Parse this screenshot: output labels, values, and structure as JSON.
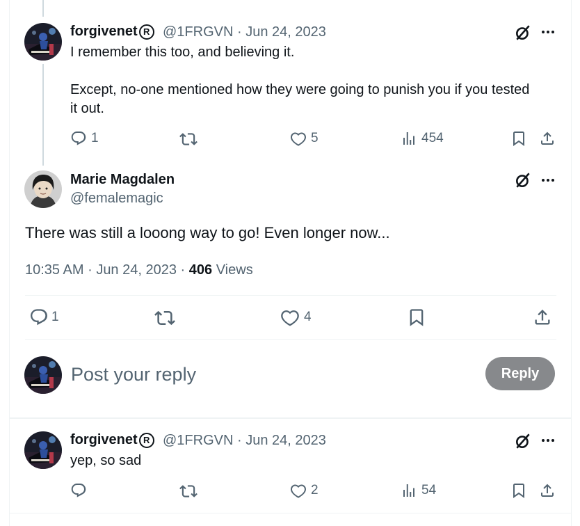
{
  "reply1": {
    "display_name": "forgivenet",
    "reg_mark": "R",
    "handle": "@1FRGVN",
    "separator": "·",
    "date": "Jun 24, 2023",
    "text_line1": "I remember this too, and believing it.",
    "text_line2": "Except, no-one mentioned how they were going to punish you if you tested",
    "text_line3": "it out.",
    "replies": "1",
    "likes": "5",
    "views": "454"
  },
  "main_post": {
    "display_name": "Marie Magdalen",
    "handle": "@femalemagic",
    "text": "There was still a looong way to go! Even longer now...",
    "time": "10:35 AM",
    "date": "Jun 24, 2023",
    "separator": "·",
    "views_count": "406",
    "views_label": "Views",
    "replies": "1",
    "likes": "4"
  },
  "composer": {
    "placeholder": "Post your reply",
    "button_label": "Reply"
  },
  "reply2": {
    "display_name": "forgivenet",
    "reg_mark": "R",
    "handle": "@1FRGVN",
    "separator": "·",
    "date": "Jun 24, 2023",
    "text": "yep, so sad",
    "likes": "2",
    "views": "54"
  },
  "icons": {
    "more": "more-horizontal-icon",
    "grok": "grok-slash-icon",
    "reply": "reply-bubble-icon",
    "retweet": "retweet-icon",
    "like": "heart-icon",
    "views": "analytics-bars-icon",
    "bookmark": "bookmark-icon",
    "share": "share-upload-icon"
  },
  "colors": {
    "text_primary": "#0f1419",
    "text_secondary": "#536471",
    "reply_button_disabled": "#87898c",
    "border": "#eff3f4"
  }
}
